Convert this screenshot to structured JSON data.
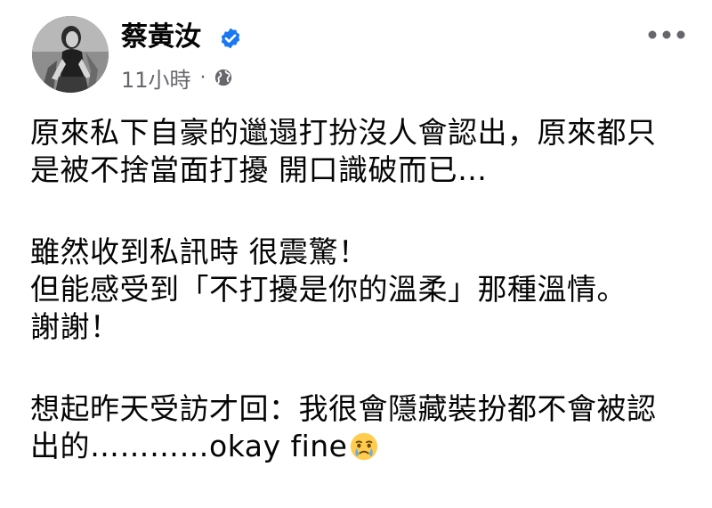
{
  "author": {
    "name": "蔡黃汝",
    "verified": true,
    "avatar_alt": "profile photo"
  },
  "meta": {
    "time": "11小時",
    "separator": "·",
    "audience_icon": "globe-icon"
  },
  "more_button": {
    "icon": "more-horizontal-icon"
  },
  "post": {
    "lines": [
      "原來私下自豪的邋遢打扮沒人會認出，原來都只",
      "是被不捨當面打擾 開口識破而已…",
      "雖然收到私訊時 很震驚！",
      "但能感受到「不打擾是你的溫柔」那種溫情。",
      "謝謝！",
      "想起昨天受訪才回：我很會隱藏裝扮都不會被認",
      "出的…………okay fine"
    ],
    "emoji": "face-holding-back-tears"
  },
  "colors": {
    "text": "#050505",
    "secondary": "#65676b",
    "verified_blue": "#1877f2"
  }
}
